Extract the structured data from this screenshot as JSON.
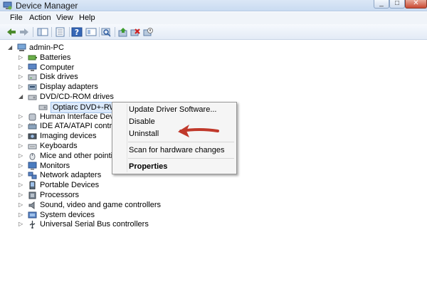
{
  "window": {
    "title": "Device Manager"
  },
  "menu": {
    "items": [
      "File",
      "Action",
      "View",
      "Help"
    ]
  },
  "tree": {
    "root": "admin-PC",
    "items": [
      {
        "label": "Batteries",
        "icon": "battery-icon",
        "expanded": false
      },
      {
        "label": "Computer",
        "icon": "computer-icon",
        "expanded": false
      },
      {
        "label": "Disk drives",
        "icon": "disk-drive-icon",
        "expanded": false
      },
      {
        "label": "Display adapters",
        "icon": "display-adapter-icon",
        "expanded": false
      },
      {
        "label": "DVD/CD-ROM drives",
        "icon": "dvd-drive-icon",
        "expanded": true,
        "children": [
          {
            "label": "Optiarc DVD+-RW AD",
            "icon": "dvd-drive-icon",
            "selected": true
          }
        ]
      },
      {
        "label": "Human Interface Devices",
        "icon": "hid-icon",
        "expanded": false
      },
      {
        "label": "IDE ATA/ATAPI controlle",
        "icon": "ide-controller-icon",
        "expanded": false
      },
      {
        "label": "Imaging devices",
        "icon": "camera-icon",
        "expanded": false
      },
      {
        "label": "Keyboards",
        "icon": "keyboard-icon",
        "expanded": false
      },
      {
        "label": "Mice and other pointing",
        "icon": "mouse-icon",
        "expanded": false
      },
      {
        "label": "Monitors",
        "icon": "monitor-icon",
        "expanded": false
      },
      {
        "label": "Network adapters",
        "icon": "network-icon",
        "expanded": false
      },
      {
        "label": "Portable Devices",
        "icon": "portable-device-icon",
        "expanded": false
      },
      {
        "label": "Processors",
        "icon": "processor-icon",
        "expanded": false
      },
      {
        "label": "Sound, video and game controllers",
        "icon": "sound-icon",
        "expanded": false
      },
      {
        "label": "System devices",
        "icon": "system-device-icon",
        "expanded": false
      },
      {
        "label": "Universal Serial Bus controllers",
        "icon": "usb-icon",
        "expanded": false
      }
    ]
  },
  "context_menu": {
    "update_driver": "Update Driver Software...",
    "disable": "Disable",
    "uninstall": "Uninstall",
    "scan": "Scan for hardware changes",
    "properties": "Properties"
  },
  "colors": {
    "annotation_arrow": "#c0392b",
    "selection": "#dbe9fb"
  }
}
